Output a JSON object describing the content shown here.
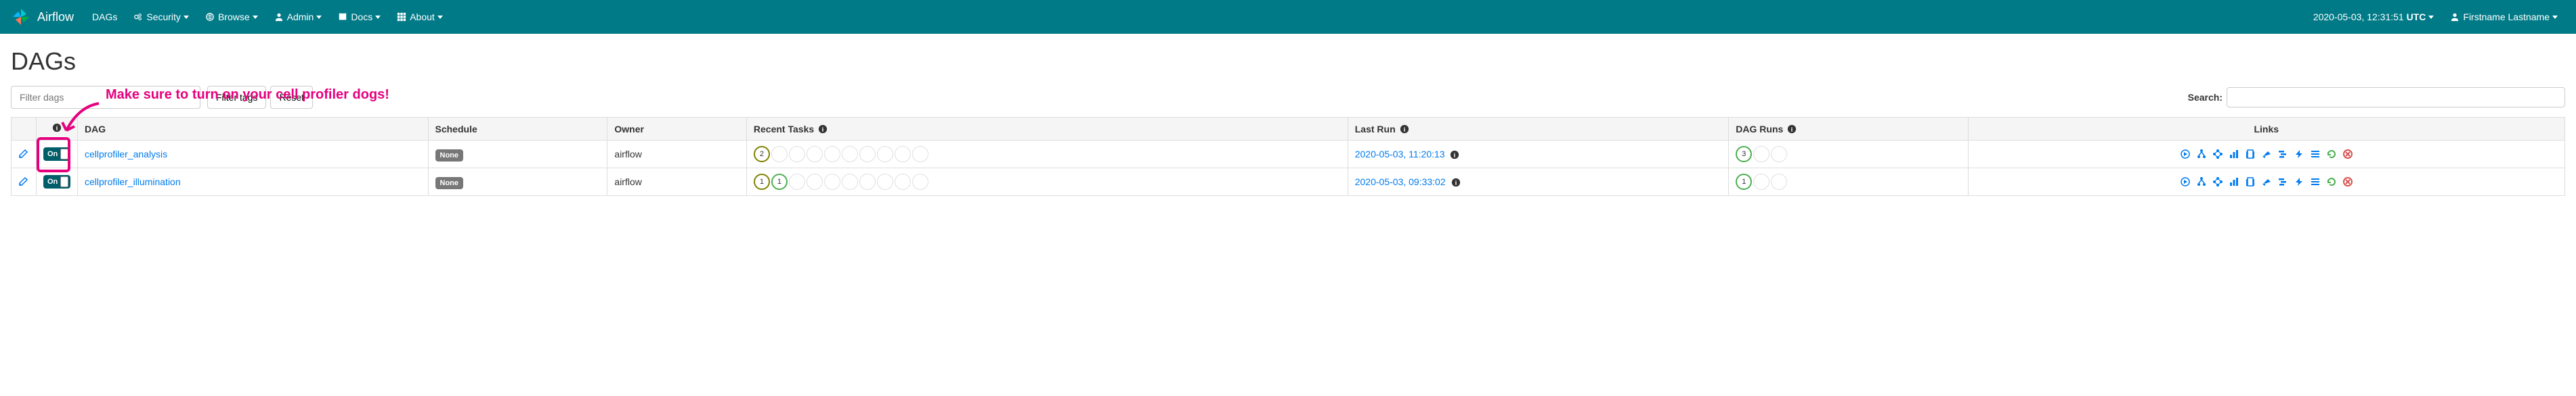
{
  "navbar": {
    "brand": "Airflow",
    "items": [
      {
        "label": "DAGs",
        "icon": null
      },
      {
        "label": "Security",
        "icon": "cogs",
        "caret": true
      },
      {
        "label": "Browse",
        "icon": "globe",
        "caret": true
      },
      {
        "label": "Admin",
        "icon": "user",
        "caret": true
      },
      {
        "label": "Docs",
        "icon": "book",
        "caret": true
      },
      {
        "label": "About",
        "icon": "grid",
        "caret": true
      }
    ],
    "clock": "2020-05-03, 12:31:51",
    "tz": "UTC",
    "user": "Firstname Lastname"
  },
  "page": {
    "title": "DAGs",
    "filter_placeholder": "Filter dags",
    "filter_tags_btn": "Filter tags",
    "reset_btn": "Reset",
    "search_label": "Search:",
    "annotation": "Make sure to turn on your cell profiler dogs!"
  },
  "columns": {
    "dag": "DAG",
    "schedule": "Schedule",
    "owner": "Owner",
    "recent_tasks": "Recent Tasks",
    "last_run": "Last Run",
    "dag_runs": "DAG Runs",
    "links": "Links"
  },
  "rows": [
    {
      "toggle": "On",
      "dag_name": "cellprofiler_analysis",
      "schedule": "None",
      "owner": "airflow",
      "recent_first": {
        "value": "2",
        "color": "olive"
      },
      "recent_second": null,
      "last_run": "2020-05-03, 11:20:13",
      "dag_runs_first": {
        "value": "3",
        "color": "green"
      }
    },
    {
      "toggle": "On",
      "dag_name": "cellprofiler_illumination",
      "schedule": "None",
      "owner": "airflow",
      "recent_first": {
        "value": "1",
        "color": "olive"
      },
      "recent_second": {
        "value": "1",
        "color": "green"
      },
      "last_run": "2020-05-03, 09:33:02",
      "dag_runs_first": {
        "value": "1",
        "color": "green"
      }
    }
  ],
  "icons": {
    "trigger": "Trigger DAG",
    "tree": "Tree View",
    "graph": "Graph View",
    "duration": "Task Duration",
    "tries": "Task Tries",
    "landing": "Landing Times",
    "gantt": "Gantt",
    "code": "Code",
    "logs": "Logs",
    "refresh": "Refresh",
    "delete": "Delete"
  }
}
